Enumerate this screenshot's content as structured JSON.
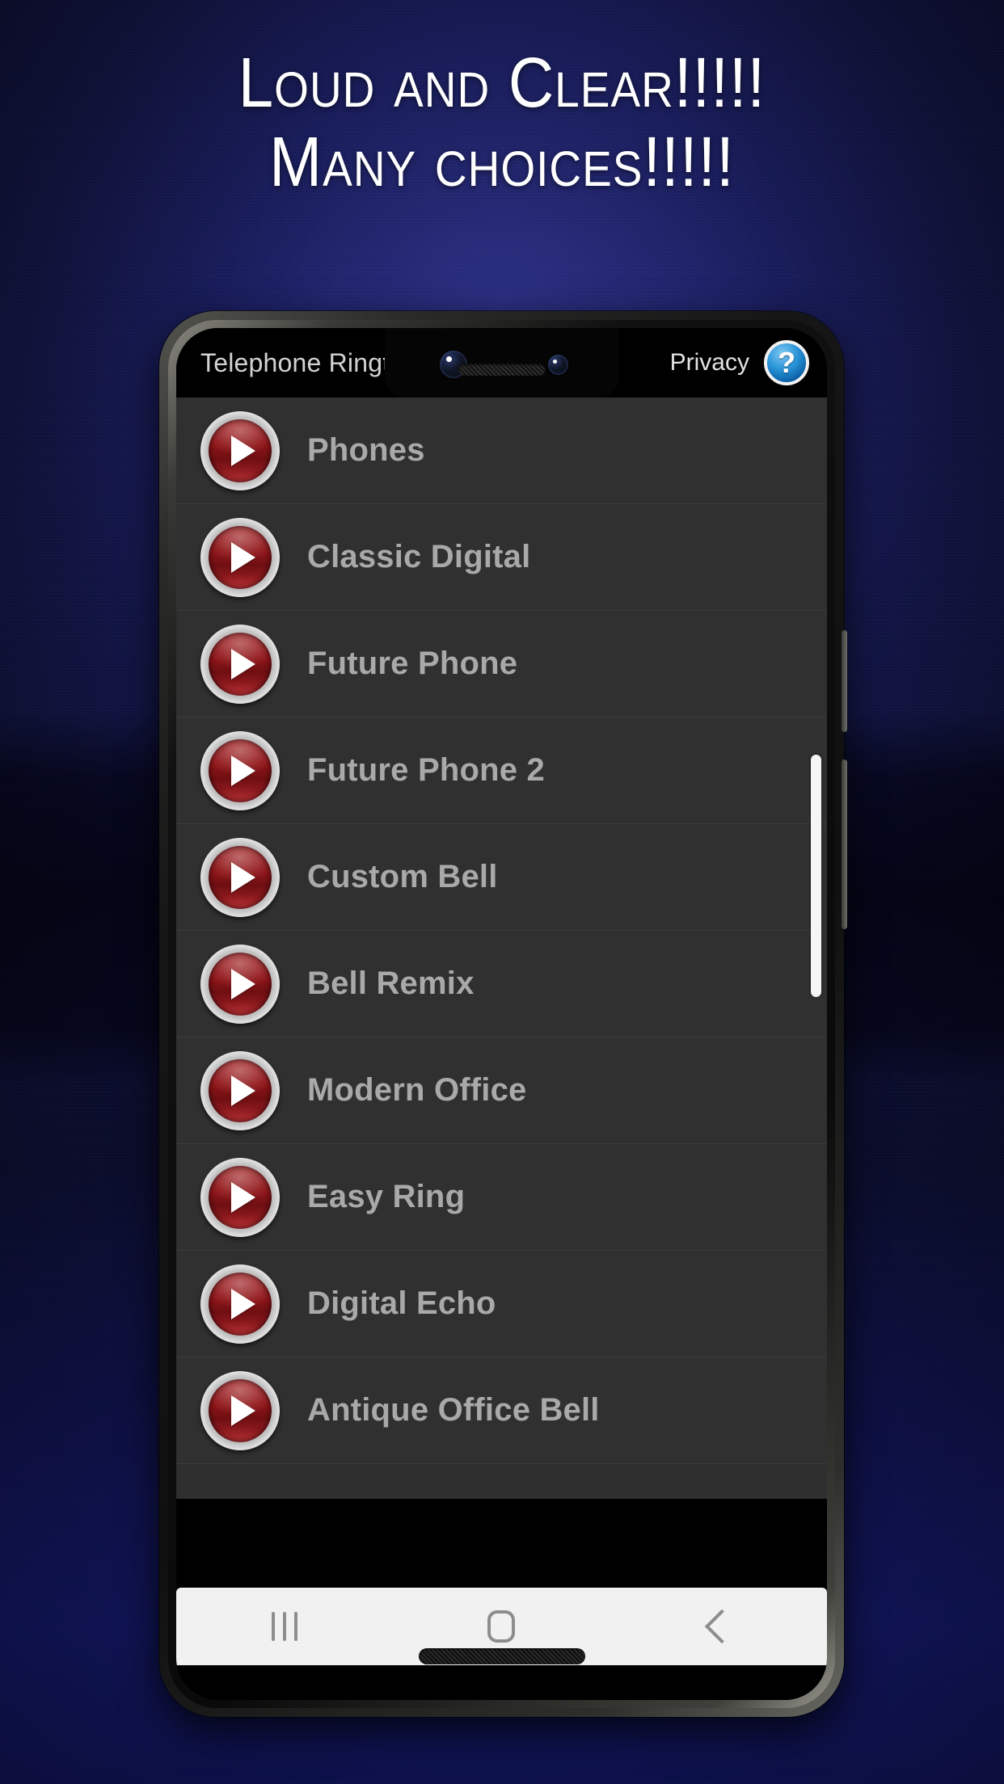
{
  "promo": {
    "headline_line1": "Loud and Clear!!!!!",
    "headline_line2": "Many choices!!!!!"
  },
  "app": {
    "title": "Telephone Ringto",
    "privacy_label": "Privacy",
    "help_icon": "help-question-icon",
    "help_glyph": "?",
    "list_items": [
      {
        "label": "Phones",
        "icon": "play-icon"
      },
      {
        "label": "Classic Digital",
        "icon": "play-icon"
      },
      {
        "label": "Future Phone",
        "icon": "play-icon"
      },
      {
        "label": "Future Phone 2",
        "icon": "play-icon"
      },
      {
        "label": "Custom Bell",
        "icon": "play-icon"
      },
      {
        "label": "Bell Remix",
        "icon": "play-icon"
      },
      {
        "label": "Modern Office",
        "icon": "play-icon"
      },
      {
        "label": "Easy Ring",
        "icon": "play-icon"
      },
      {
        "label": "Digital Echo",
        "icon": "play-icon"
      },
      {
        "label": "Antique Office Bell",
        "icon": "play-icon"
      }
    ]
  },
  "navbar": {
    "recents": "recents-icon",
    "home": "home-icon",
    "back": "back-icon"
  },
  "colors": {
    "accent_red": "#8e1418",
    "help_blue": "#2a95d8",
    "list_bg": "#303030",
    "label_gray": "#a9a9a9",
    "headline_white": "#ffffff",
    "eq_cyan": "#31e6f5",
    "eq_blue": "#1d4fd8"
  },
  "equalizers": [
    {
      "name": "eq-left-1",
      "segments": [
        1,
        1,
        1,
        1,
        1,
        1,
        1,
        0,
        1,
        1,
        1,
        1,
        1,
        0
      ],
      "levels": [
        "hi",
        "hi",
        "hi",
        "hi",
        "hi",
        "hi",
        "mid",
        "off",
        "mid",
        "mid",
        "lo",
        "lo",
        "lo",
        "off"
      ]
    },
    {
      "name": "eq-left-2",
      "segments": [
        1,
        1,
        1,
        1,
        1,
        0,
        1,
        1,
        1,
        1,
        1,
        1,
        0,
        0
      ],
      "levels": [
        "hi",
        "hi",
        "mid",
        "mid",
        "lo",
        "off",
        "mid",
        "mid",
        "lo",
        "lo",
        "lo",
        "lo",
        "off",
        "off"
      ]
    },
    {
      "name": "eq-right-1",
      "segments": [
        1,
        1,
        1,
        1,
        1,
        1,
        1,
        0,
        1,
        1,
        1,
        1,
        0,
        0
      ],
      "levels": [
        "hi",
        "hi",
        "hi",
        "mid",
        "mid",
        "mid",
        "lo",
        "off",
        "lo",
        "lo",
        "lo",
        "lo",
        "off",
        "off"
      ]
    },
    {
      "name": "eq-right-2",
      "segments": [
        1,
        1,
        1,
        1,
        0,
        1,
        1,
        1,
        1,
        1,
        1,
        0,
        0,
        0
      ],
      "levels": [
        "hi",
        "hi",
        "mid",
        "mid",
        "off",
        "mid",
        "lo",
        "lo",
        "lo",
        "lo",
        "lo",
        "off",
        "off",
        "off"
      ]
    }
  ]
}
